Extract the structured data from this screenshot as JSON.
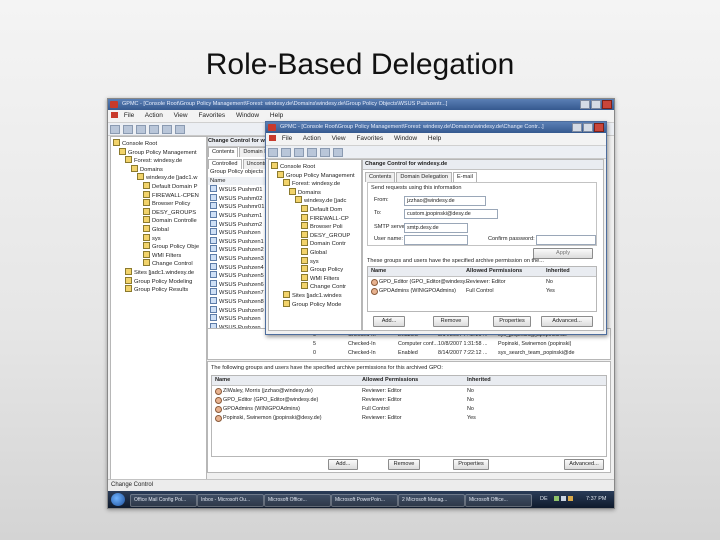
{
  "slide": {
    "title": "Role-Based Delegation"
  },
  "back_window": {
    "title": "GPMC - [Console Root\\Group Policy Management\\Forest: windesy.de\\Domains\\windesy.de\\Group Policy Objects\\WSUS Pushzentr...]",
    "menu": [
      "File",
      "Action",
      "View",
      "Favorites",
      "Window",
      "Help"
    ],
    "tree": [
      {
        "label": "Console Root",
        "indent": 0
      },
      {
        "label": "Group Policy Management",
        "indent": 1
      },
      {
        "label": "Forest: windesy.de",
        "indent": 2
      },
      {
        "label": "Domains",
        "indent": 3
      },
      {
        "label": "windesy.de [jadc1.w",
        "indent": 4
      },
      {
        "label": "Default Domain P",
        "indent": 5
      },
      {
        "label": "FIREWALL-CPEN",
        "indent": 5
      },
      {
        "label": "Browser Policy",
        "indent": 5
      },
      {
        "label": "DESY_GROUPS",
        "indent": 5
      },
      {
        "label": "Domain Controlle",
        "indent": 5
      },
      {
        "label": "Global",
        "indent": 5
      },
      {
        "label": "sys",
        "indent": 5
      },
      {
        "label": "Group Policy Obje",
        "indent": 5
      },
      {
        "label": "WMI Filters",
        "indent": 5
      },
      {
        "label": "Change Control",
        "indent": 5
      },
      {
        "label": "Sites [jadc1.windesy.de",
        "indent": 2
      },
      {
        "label": "Group Policy Modeling",
        "indent": 2
      },
      {
        "label": "Group Policy Results",
        "indent": 2
      }
    ],
    "mid_header": "Change Control for windesy.de",
    "mid_tabs": [
      "Contents",
      "Domain Delegation"
    ],
    "mid_subtabs": [
      "Controlled",
      "Uncontrolled"
    ],
    "mid_caption": "Group Policy objects",
    "mid_col": "Name",
    "mid_items": [
      "WSUS Pushm01",
      "WSUS Pushm02",
      "WSUS Pushmr01",
      "WSUS Pushzm1",
      "WSUS Pushzm2",
      "WSUS Pushzen",
      "WSUS Pushzen1",
      "WSUS Pushzen2",
      "WSUS Pushzen3",
      "WSUS Pushzen4",
      "WSUS Pushzen5",
      "WSUS Pushzen6",
      "WSUS Pushzen7",
      "WSUS Pushzen8",
      "WSUS Pushzen9",
      "WSUS Pushzen",
      "WSUS Pushzen",
      "ZP_SRS_aN",
      "sf_HDE",
      "all_Team_User",
      "sys_Search"
    ],
    "grid_rows": [
      {
        "c1": "0",
        "c2": "Checked-In",
        "c3": "Enabled",
        "c4": "8/14/2007 7:42:20 ...",
        "c5": "sys_jpopinski@jupopinski.de"
      },
      {
        "c1": "5",
        "c2": "Checked-In",
        "c3": "Computer conf...",
        "c4": "10/8/2007 1:31:58 ...",
        "c5": "Popinski, Swinemon (popinski)"
      },
      {
        "c1": "0",
        "c2": "Checked-In",
        "c3": "Enabled",
        "c4": "8/14/2007 7:22:12 ...",
        "c5": "sys_search_team_popinski@de"
      }
    ],
    "perm_caption": "The following groups and users have the specified archive permissions for this archived GPO:",
    "perm_headers": [
      "Name",
      "Allowed Permissions",
      "Inherited"
    ],
    "perm_rows": [
      {
        "name": "ZIWaley, Morris (jzzhao@windesy.de)",
        "perm": "Reviewer: Editor",
        "inh": "No"
      },
      {
        "name": "GPO_Editor (GPO_Editor@windesy.de)",
        "perm": "Reviewer: Editor",
        "inh": "No"
      },
      {
        "name": "GPOAdmins (WIN\\GPOAdmins)",
        "perm": "Full Control",
        "inh": "No"
      },
      {
        "name": "Popinski, Swinemon (jpopinski@desy.de)",
        "perm": "Reviewer: Editor",
        "inh": "Yes"
      }
    ],
    "buttons": {
      "add": "Add...",
      "remove": "Remove",
      "properties": "Properties",
      "advanced": "Advanced..."
    },
    "status": "Change Control"
  },
  "front_window": {
    "title": "GPMC - [Console Root\\Group Policy Management\\Forest: windesy.de\\Domains\\windesy.de\\Change Contr...]",
    "menu": [
      "File",
      "Action",
      "View",
      "Favorites",
      "Window",
      "Help"
    ],
    "tree": [
      {
        "label": "Console Root",
        "indent": 0
      },
      {
        "label": "Group Policy Management",
        "indent": 1
      },
      {
        "label": "Forest: windesy.de",
        "indent": 2
      },
      {
        "label": "Domains",
        "indent": 3
      },
      {
        "label": "windesy.de [jadc",
        "indent": 4
      },
      {
        "label": "Default Dom",
        "indent": 5
      },
      {
        "label": "FIREWALL-CP",
        "indent": 5
      },
      {
        "label": "Browser Poli",
        "indent": 5
      },
      {
        "label": "DESY_GROUP",
        "indent": 5
      },
      {
        "label": "Domain Contr",
        "indent": 5
      },
      {
        "label": "Global",
        "indent": 5
      },
      {
        "label": "sys",
        "indent": 5
      },
      {
        "label": "Group Policy",
        "indent": 5
      },
      {
        "label": "WMI Filters",
        "indent": 5
      },
      {
        "label": "Change Contr",
        "indent": 5
      },
      {
        "label": "Sites [jadc1.windes",
        "indent": 2
      },
      {
        "label": "Group Policy Mode",
        "indent": 2
      }
    ],
    "panel_header": "Change Control for windesy.de",
    "tabs": [
      "Contents",
      "Domain Delegation",
      "E-mail"
    ],
    "group_label": "Send requests using this information",
    "from_label": "From:",
    "from_value": "jzzhao@windesy.de",
    "to_label": "To:",
    "to_value": "custom.jpopinski@desy.de",
    "smtp_label": "SMTP server:",
    "smtp_value": "smtp.desy.de",
    "user_label": "User name:",
    "password_label": "Confirm password:",
    "apply": "Apply",
    "perm_caption": "These groups and users have the specified archive permission on the...",
    "perm_headers": [
      "Name",
      "Allowed Permissions",
      "Inherited"
    ],
    "perm_rows": [
      {
        "name": "GPO_Editor (GPO_Editor@windesy...",
        "perm": "Reviewer: Editor",
        "inh": "No"
      },
      {
        "name": "GPOAdmins (WIN\\GPOAdmins)",
        "perm": "Full Control",
        "inh": "Yes"
      }
    ],
    "buttons": {
      "add": "Add...",
      "remove": "Remove",
      "properties": "Properties",
      "advanced": "Advanced..."
    }
  },
  "taskbar": {
    "items": [
      "Office Mail Config Pol...",
      "Inbox - Microsoft Ou...",
      "Microsoft Office...",
      "Microsoft PowerPoin...",
      "2 Microsoft Manag...",
      "Microsoft Office..."
    ],
    "lang": "DE",
    "clock": "7:37 PM"
  },
  "colors": {
    "titlebar": "#35598f",
    "taskbar": "#0f1a2c"
  }
}
